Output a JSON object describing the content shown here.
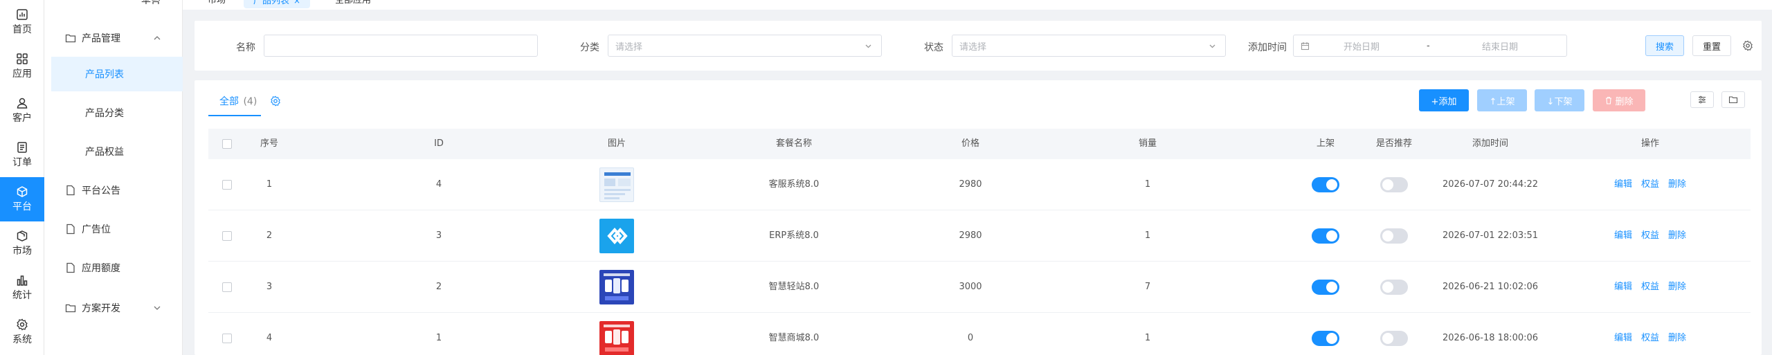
{
  "rail": {
    "items": [
      {
        "label": "首页",
        "icon": "dashboard-icon"
      },
      {
        "label": "应用",
        "icon": "apps-grid-icon"
      },
      {
        "label": "客户",
        "icon": "user-icon"
      },
      {
        "label": "订单",
        "icon": "order-document-icon"
      },
      {
        "label": "平台",
        "icon": "cube-icon",
        "active": true
      },
      {
        "label": "市场",
        "icon": "market-box-icon"
      },
      {
        "label": "统计",
        "icon": "bar-chart-icon"
      },
      {
        "label": "系统",
        "icon": "gear-icon"
      }
    ]
  },
  "submenu": {
    "top_label": "平台",
    "product_management": "产品管理",
    "product_list": "产品列表",
    "product_category": "产品分类",
    "product_rights": "产品权益",
    "announcement": "平台公告",
    "ad_slot": "广告位",
    "app_quota": "应用额度",
    "solution_dev": "方案开发"
  },
  "tabs": {
    "market": "市场",
    "product_list": "产品列表",
    "close": "×",
    "all_apps": "全部应用"
  },
  "filter": {
    "name_label": "名称",
    "name_value": "",
    "category_label": "分类",
    "category_placeholder": "请选择",
    "status_label": "状态",
    "status_placeholder": "请选择",
    "time_label": "添加时间",
    "start_date": "开始日期",
    "date_sep": "-",
    "end_date": "结束日期",
    "search": "搜索",
    "reset": "重置"
  },
  "table": {
    "tab_all": "全部",
    "tab_count": "(4)",
    "add": "+添加",
    "on_shelf": "↑上架",
    "off_shelf": "↓下架",
    "delete": "删除",
    "columns": {
      "index": "序号",
      "id": "ID",
      "image": "图片",
      "name": "套餐名称",
      "price": "价格",
      "sales": "销量",
      "on_shelf": "上架",
      "recommend": "是否推荐",
      "added": "添加时间",
      "actions": "操作"
    },
    "rows": [
      {
        "index": "1",
        "id": "4",
        "name": "客服系统8.0",
        "price": "2980",
        "sales": "1",
        "on_shelf": true,
        "recommend": false,
        "added": "2026-07-07 20:44:22",
        "thumb": "light"
      },
      {
        "index": "2",
        "id": "3",
        "name": "ERP系统8.0",
        "price": "2980",
        "sales": "1",
        "on_shelf": true,
        "recommend": false,
        "added": "2026-07-01 22:03:51",
        "thumb": "erp"
      },
      {
        "index": "3",
        "id": "2",
        "name": "智慧轻站8.0",
        "price": "3000",
        "sales": "7",
        "on_shelf": true,
        "recommend": false,
        "added": "2026-06-21 10:02:06",
        "thumb": "blue"
      },
      {
        "index": "4",
        "id": "1",
        "name": "智慧商城8.0",
        "price": "0",
        "sales": "1",
        "on_shelf": true,
        "recommend": false,
        "added": "2026-06-18 18:00:06",
        "thumb": "red"
      }
    ],
    "op_edit": "编辑",
    "op_rights": "权益",
    "op_delete": "删除"
  },
  "colors": {
    "primary": "#1890ff",
    "primary_disabled": "#a0cfff",
    "danger_disabled": "#fab6b6"
  }
}
